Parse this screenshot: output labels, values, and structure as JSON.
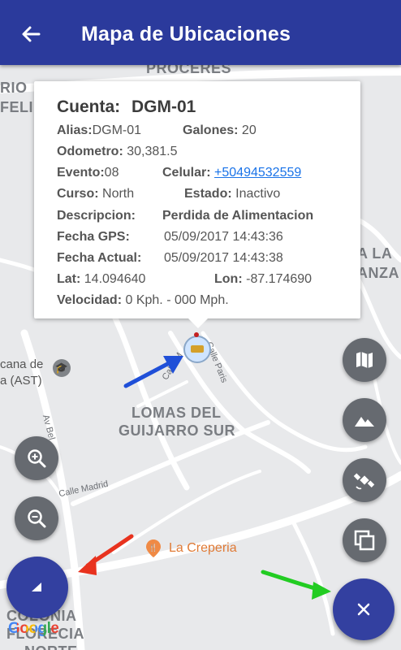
{
  "appbar": {
    "title": "Mapa de Ubicaciones",
    "back_icon": "arrow-left-icon"
  },
  "map": {
    "labels": {
      "proceres": "PROCERES",
      "rio": "RIO",
      "felipe": "FELIPE",
      "la": "A LA",
      "anza": "ANZA",
      "lomas1": "LOMAS DEL",
      "lomas2": "GUIJARRO SUR",
      "colonia1": "COLONIA",
      "colonia2": "FLORECIA",
      "colonia3": "NORTE",
      "cana1": "cana de",
      "cana2": "a (AST)"
    },
    "streets": {
      "calle_madrid": "Calle Madrid",
      "calle_paris": "Calle Paris",
      "calle_m": "Calle M",
      "av_bel": "Av Bel"
    },
    "poi": {
      "name": "La Creperia"
    }
  },
  "infowindow": {
    "title_label": "Cuenta:",
    "title_value": "DGM-01",
    "alias_label": "Alias:",
    "alias_value": "DGM-01",
    "galones_label": "Galones:",
    "galones_value": "20",
    "odometro_label": "Odometro:",
    "odometro_value": "30,381.5",
    "evento_label": "Evento:",
    "evento_value": "08",
    "celular_label": "Celular:",
    "celular_value": "+50494532559",
    "curso_label": "Curso:",
    "curso_value": "North",
    "estado_label": "Estado:",
    "estado_value": "Inactivo",
    "descripcion_label": "Descripcion:",
    "descripcion_value": "Perdida de Alimentacion",
    "fechagps_label": "Fecha GPS:",
    "fechagps_value": "05/09/2017 14:43:36",
    "fechaactual_label": "Fecha Actual:",
    "fechaactual_value": "05/09/2017 14:43:38",
    "lat_label": "Lat:",
    "lat_value": "14.094640",
    "lon_label": "Lon:",
    "lon_value": "-87.174690",
    "velocidad_label": "Velocidad:",
    "velocidad_value": "0 Kph. - 000 Mph."
  },
  "controls": {
    "zoom_in_icon": "zoom-in-icon",
    "zoom_out_icon": "zoom-out-icon",
    "map_icon": "map-icon",
    "terrain_icon": "terrain-icon",
    "satellite_icon": "satellite-icon",
    "layers_icon": "layers-icon",
    "close_icon": "close-icon",
    "compass_icon": "compass-icon"
  },
  "colors": {
    "appbar": "#2b3a9c",
    "fab_primary": "#3340a0",
    "fab_secondary": "#666a70",
    "arrow_blue": "#1f4fd8",
    "arrow_red": "#e8321e",
    "arrow_green": "#22cc22"
  },
  "google_logo": "Google"
}
